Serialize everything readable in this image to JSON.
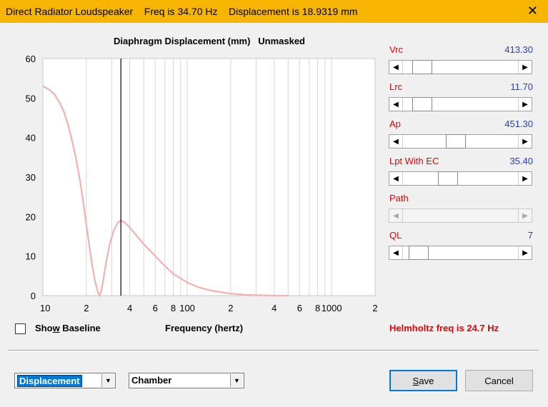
{
  "window": {
    "title": "Direct Radiator Loudspeaker    Freq is 34.70 Hz    Displacement is 18.9319 mm",
    "close_glyph": "✕"
  },
  "chart_data": {
    "type": "line",
    "title": "Diaphragm Displacement (mm)   Unmasked",
    "xlabel": "Frequency (hertz)",
    "ylabel": "",
    "x_scale": "log",
    "xlim": [
      10,
      2000
    ],
    "ylim": [
      0,
      60
    ],
    "y_ticks": [
      0,
      10,
      20,
      30,
      40,
      50,
      60
    ],
    "x_tick_labels": [
      {
        "x": 10,
        "label": "10"
      },
      {
        "x": 20,
        "label": "2"
      },
      {
        "x": 40,
        "label": "4"
      },
      {
        "x": 60,
        "label": "6"
      },
      {
        "x": 80,
        "label": "8"
      },
      {
        "x": 100,
        "label": "100"
      },
      {
        "x": 200,
        "label": "2"
      },
      {
        "x": 400,
        "label": "4"
      },
      {
        "x": 600,
        "label": "6"
      },
      {
        "x": 800,
        "label": "8"
      },
      {
        "x": 1000,
        "label": "1000"
      },
      {
        "x": 2000,
        "label": "2"
      }
    ],
    "grid": true,
    "marker_x": 34.7,
    "series": [
      {
        "color": "#f4b0b0",
        "x": [
          10,
          11,
          12,
          13,
          14,
          15,
          16,
          17,
          18,
          19,
          20,
          21,
          22,
          23,
          24,
          24.7,
          25.5,
          27,
          29,
          31,
          33,
          34.7,
          37,
          40,
          45,
          50,
          60,
          70,
          80,
          100,
          120,
          150,
          200,
          250,
          300,
          400,
          500
        ],
        "y": [
          53,
          52.2,
          51,
          49,
          46.5,
          43,
          39,
          34.5,
          29.5,
          24,
          18,
          12.5,
          7.5,
          3.5,
          1,
          0,
          1.5,
          7,
          13,
          16.5,
          18.5,
          19.0,
          18.5,
          17.2,
          15,
          13,
          10,
          7.5,
          5.5,
          3.3,
          2.1,
          1.2,
          0.5,
          0.2,
          0.1,
          0,
          0
        ]
      }
    ]
  },
  "sliders": [
    {
      "label": "Vrc",
      "value": "413.30",
      "thumb_pos": 0.1,
      "disabled": false
    },
    {
      "label": "Lrc",
      "value": "11.70",
      "thumb_pos": 0.1,
      "disabled": false
    },
    {
      "label": "Ap",
      "value": "451.30",
      "thumb_pos": 0.45,
      "disabled": false
    },
    {
      "label": "Lpt  With EC",
      "value": "35.40",
      "thumb_pos": 0.37,
      "disabled": false
    },
    {
      "label": "Path",
      "value": "",
      "thumb_pos": null,
      "disabled": true
    },
    {
      "label": "QL",
      "value": "7",
      "thumb_pos": 0.07,
      "disabled": false
    }
  ],
  "baseline": {
    "label_pre": "Sho",
    "label_accel": "w",
    "label_post": " Baseline",
    "checked": false
  },
  "helmholtz": "Helmholtz freq is 24.7 Hz",
  "plot_select": {
    "value": "Displacement"
  },
  "chamber_select": {
    "value": "Chamber"
  },
  "save_button": {
    "accel": "S",
    "rest": "ave"
  },
  "cancel_button": {
    "label": "Cancel"
  }
}
